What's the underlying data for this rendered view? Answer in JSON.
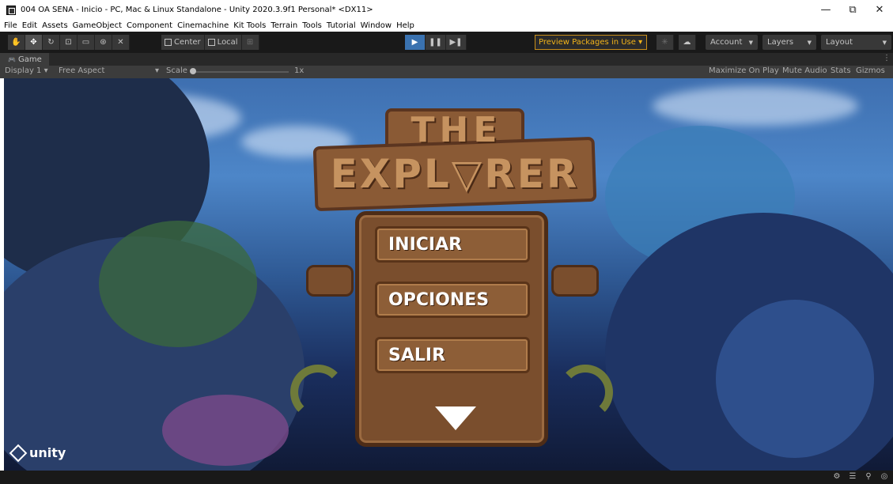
{
  "window": {
    "title": "004 OA SENA - Inicio - PC, Mac & Linux Standalone - Unity 2020.3.9f1 Personal* <DX11>",
    "controls": {
      "minimize": "—",
      "maximize": "⧉",
      "close": "✕"
    }
  },
  "menu": [
    "File",
    "Edit",
    "Assets",
    "GameObject",
    "Component",
    "Cinemachine",
    "Kit Tools",
    "Terrain",
    "Tools",
    "Tutorial",
    "Window",
    "Help"
  ],
  "toolbar": {
    "pivot_label": "Center",
    "space_label": "Local",
    "preview_packages": "Preview Packages in Use ▾",
    "account_label": "Account",
    "layers_label": "Layers",
    "layout_label": "Layout"
  },
  "game_tab": {
    "label": "Game"
  },
  "game_toolbar": {
    "display": "Display 1",
    "aspect": "Free Aspect",
    "scale_label": "Scale",
    "scale_value": "1x",
    "scale_level": 0.0,
    "maximize_on_play": "Maximize On Play",
    "mute_audio": "Mute Audio",
    "stats": "Stats",
    "gizmos": "Gizmos"
  },
  "game": {
    "logo_line1": "THE",
    "logo_line2": "EXPL▽RER",
    "buttons": [
      "INICIAR",
      "OPCIONES",
      "SALIR"
    ],
    "engine_logo": "unity"
  }
}
